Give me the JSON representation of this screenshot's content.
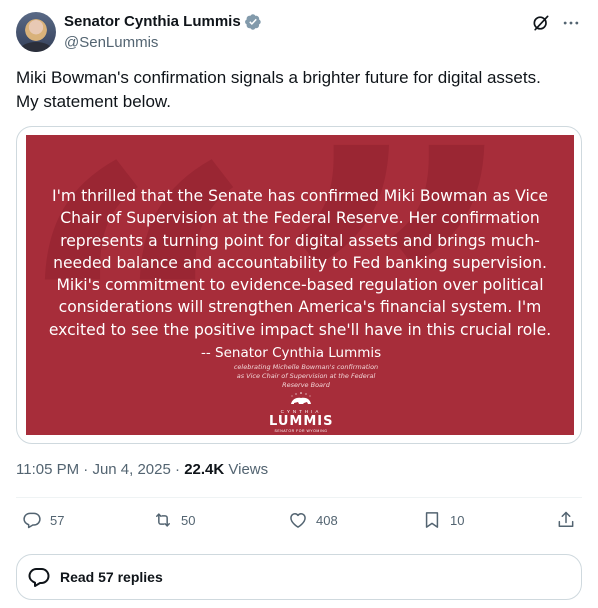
{
  "author": {
    "name": "Senator Cynthia Lummis",
    "handle": "@SenLummis",
    "verified": true,
    "badge_color": "#829aab"
  },
  "tweet": {
    "lines": [
      "Miki Bowman's confirmation signals a brighter future for digital assets.",
      "My statement below."
    ]
  },
  "image": {
    "background_color": "#a72d3a",
    "statement_lines": [
      "I'm thrilled that the Senate has confirmed Miki Bowman as Vice",
      "Chair of Supervision at the Federal Reserve. Her confirmation",
      "represents a turning point for digital assets and brings much-",
      "needed balance and accountability to Fed banking supervision.",
      "Miki's commitment to evidence-based regulation over political",
      "considerations will strengthen America's financial system. I'm",
      "excited to see the positive impact she'll have in this crucial role."
    ],
    "signature": "-- Senator Cynthia Lummis",
    "signature_sub": [
      "celebrating Michelle Bowman's confirmation",
      "as Vice Chair of Supervision at the Federal",
      "Reserve Board"
    ],
    "logo_top": "CYNTHIA",
    "logo_name": "LUMMIS",
    "logo_tagline": "SENATOR FOR WYOMING"
  },
  "meta": {
    "time": "11:05 PM",
    "date": "Jun 4, 2025",
    "views_count": "22.4K",
    "views_label": "Views",
    "separator": "·"
  },
  "actions": {
    "replies": "57",
    "reposts": "50",
    "likes": "408",
    "bookmarks": "10"
  },
  "read_replies": "Read 57 replies",
  "icons": [
    "grok-icon",
    "more-icon",
    "reply-icon",
    "repost-icon",
    "like-icon",
    "bookmark-icon",
    "share-icon",
    "verified-badge-icon"
  ]
}
